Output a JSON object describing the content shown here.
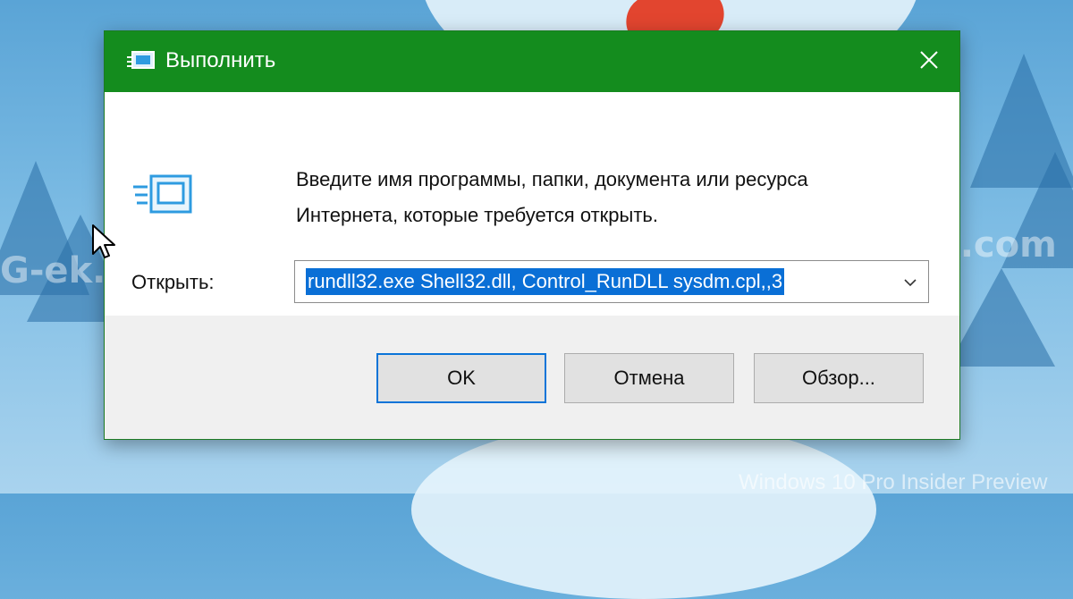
{
  "wallpaper": {
    "watermark": "G-ek.com",
    "caption": "Windows 10 Pro Insider Preview",
    "colors": {
      "sky": "#7dbce4",
      "tree": "#2d6fa5",
      "scarf": "#e2452f"
    }
  },
  "dialog": {
    "title": "Выполнить",
    "title_icon": "run-icon",
    "close_icon": "close-icon",
    "accent_color": "#148c1e",
    "prompt_line1": "Введите имя программы, папки, документа или ресурса",
    "prompt_line2": "Интернета, которые требуется открыть.",
    "open_label": "Открыть:",
    "open_value": "rundll32.exe Shell32.dll, Control_RunDLL sysdm.cpl,,3",
    "selection_color": "#0a6fd6",
    "buttons": {
      "ok": "OK",
      "cancel": "Отмена",
      "browse": "Обзор..."
    }
  }
}
